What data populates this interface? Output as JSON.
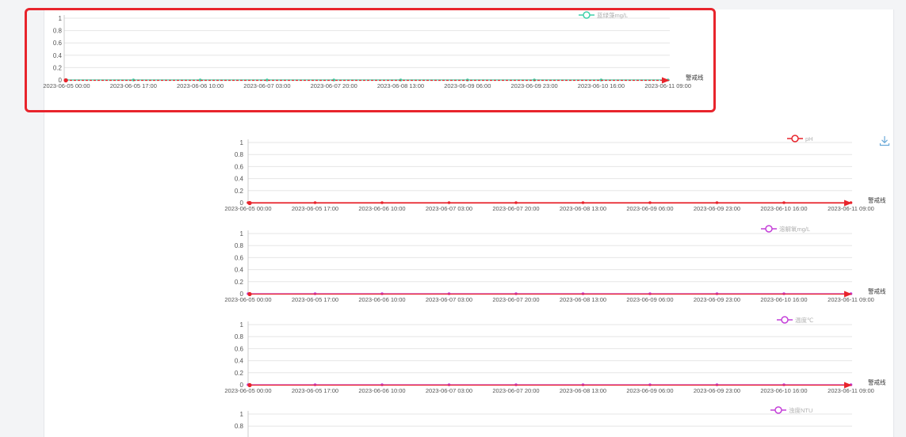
{
  "alert_line_label": "警戒线",
  "chart_data": [
    {
      "type": "line",
      "categories": [
        "2023-06-05 00:00",
        "2023-06-05 17:00",
        "2023-06-06 10:00",
        "2023-06-07 03:00",
        "2023-06-07 20:00",
        "2023-06-08 13:00",
        "2023-06-09 06:00",
        "2023-06-09 23:00",
        "2023-06-10 16:00",
        "2023-06-11 09:00"
      ],
      "series": [
        {
          "name": "蓝绿藻mg/L",
          "values": [
            0,
            0,
            0,
            0,
            0,
            0,
            0,
            0,
            0,
            0
          ],
          "color": "#3fd1a8"
        }
      ],
      "alert_line": {
        "label": "警戒线",
        "value": 0,
        "color": "#e8242c"
      },
      "yticks": [
        "0",
        "0.2",
        "0.4",
        "0.6",
        "0.8",
        "1"
      ],
      "ylim": [
        0,
        1
      ]
    },
    {
      "type": "line",
      "categories": [
        "2023-06-05 00:00",
        "2023-06-05 17:00",
        "2023-06-06 10:00",
        "2023-06-07 03:00",
        "2023-06-07 20:00",
        "2023-06-08 13:00",
        "2023-06-09 06:00",
        "2023-06-09 23:00",
        "2023-06-10 16:00",
        "2023-06-11 09:00"
      ],
      "series": [
        {
          "name": "pH",
          "values": [
            0,
            0,
            0,
            0,
            0,
            0,
            0,
            0,
            0,
            0
          ],
          "color": "#e8242c"
        }
      ],
      "alert_line": {
        "label": "警戒线",
        "value": 0,
        "color": "#e8242c"
      },
      "yticks": [
        "0",
        "0.2",
        "0.4",
        "0.6",
        "0.8",
        "1"
      ],
      "ylim": [
        0,
        1
      ]
    },
    {
      "type": "line",
      "categories": [
        "2023-06-05 00:00",
        "2023-06-05 17:00",
        "2023-06-06 10:00",
        "2023-06-07 03:00",
        "2023-06-07 20:00",
        "2023-06-08 13:00",
        "2023-06-09 06:00",
        "2023-06-09 23:00",
        "2023-06-10 16:00",
        "2023-06-11 09:00"
      ],
      "series": [
        {
          "name": "溶解氧mg/L",
          "values": [
            0,
            0,
            0,
            0,
            0,
            0,
            0,
            0,
            0,
            0
          ],
          "color": "#c43fd8"
        }
      ],
      "alert_line": {
        "label": "警戒线",
        "value": 0,
        "color": "#e8242c"
      },
      "yticks": [
        "0",
        "0.2",
        "0.4",
        "0.6",
        "0.8",
        "1"
      ],
      "ylim": [
        0,
        1
      ]
    },
    {
      "type": "line",
      "categories": [
        "2023-06-05 00:00",
        "2023-06-05 17:00",
        "2023-06-06 10:00",
        "2023-06-07 03:00",
        "2023-06-07 20:00",
        "2023-06-08 13:00",
        "2023-06-09 06:00",
        "2023-06-09 23:00",
        "2023-06-10 16:00",
        "2023-06-11 09:00"
      ],
      "series": [
        {
          "name": "温度℃",
          "values": [
            0,
            0,
            0,
            0,
            0,
            0,
            0,
            0,
            0,
            0
          ],
          "color": "#c43fd8"
        }
      ],
      "alert_line": {
        "label": "警戒线",
        "value": 0,
        "color": "#e8242c"
      },
      "yticks": [
        "0",
        "0.2",
        "0.4",
        "0.6",
        "0.8",
        "1"
      ],
      "ylim": [
        0,
        1
      ]
    },
    {
      "type": "line",
      "categories": [],
      "series": [
        {
          "name": "浊度NTU",
          "values": [],
          "color": "#c43fd8"
        }
      ],
      "yticks": [
        "1",
        "0.8"
      ],
      "ylim": [
        0,
        1
      ]
    }
  ],
  "icons": {
    "download": "download-icon"
  },
  "colors": {
    "highlight": "#e8242c",
    "grid": "#e6e6e6",
    "axis": "#888888",
    "label": "#555555",
    "legend_text": "#b0b0b0"
  }
}
